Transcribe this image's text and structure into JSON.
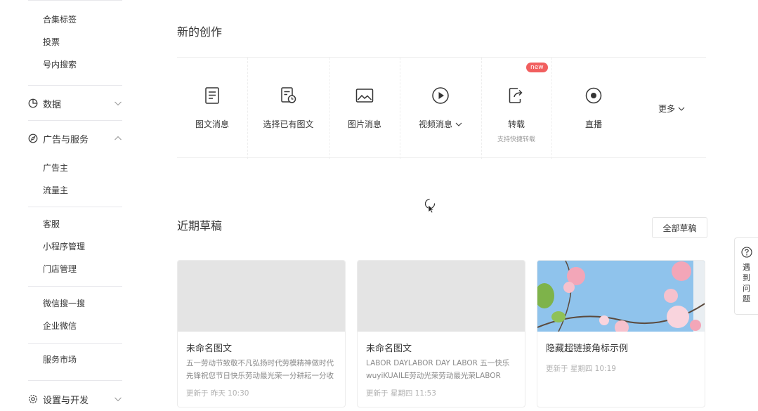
{
  "sidebar": {
    "links_top": [
      "合集标签",
      "投票",
      "号内搜索"
    ],
    "group_data": "数据",
    "group_ads": "广告与服务",
    "links_ads": [
      "广告主",
      "流量主"
    ],
    "links_service": [
      "客服",
      "小程序管理",
      "门店管理"
    ],
    "links_wechat": [
      "微信搜一搜",
      "企业微信"
    ],
    "link_market": "服务市场",
    "group_settings": "设置与开发"
  },
  "main": {
    "new_creation_title": "新的创作",
    "create_items": [
      {
        "label": "图文消息",
        "icon": "document-icon"
      },
      {
        "label": "选择已有图文",
        "icon": "document-clock-icon"
      },
      {
        "label": "图片消息",
        "icon": "image-icon"
      },
      {
        "label": "视频消息",
        "icon": "play-circle-icon"
      },
      {
        "label": "转载",
        "icon": "share-icon",
        "badge": "new",
        "sub": "支持快捷转载"
      },
      {
        "label": "直播",
        "icon": "live-icon"
      }
    ],
    "more_label": "更多",
    "recent_drafts_title": "近期草稿",
    "all_drafts_label": "全部草稿",
    "drafts": [
      {
        "title": "未命名图文",
        "desc": "五一劳动节致敬不凡弘扬时代劳模精神做时代先锋祝您节日快乐劳动最光荣一分耕耘一分收获",
        "time": "更新于 昨天 10:30"
      },
      {
        "title": "未命名图文",
        "desc": "LABOR DAYLABOR DAY LABOR 五一快乐wuyiKUAILE劳动光荣劳动最光荣LABOR",
        "time": "更新于 星期四 11:53"
      },
      {
        "title": "隐藏超链接角标示例",
        "desc": "",
        "time": "更新于 星期四 10:19"
      }
    ]
  },
  "help": {
    "label": "遇到问题"
  },
  "colors": {
    "badge": "#f15f5f",
    "sky": "#8fc3ec",
    "blossom": "#f3a6b8"
  }
}
